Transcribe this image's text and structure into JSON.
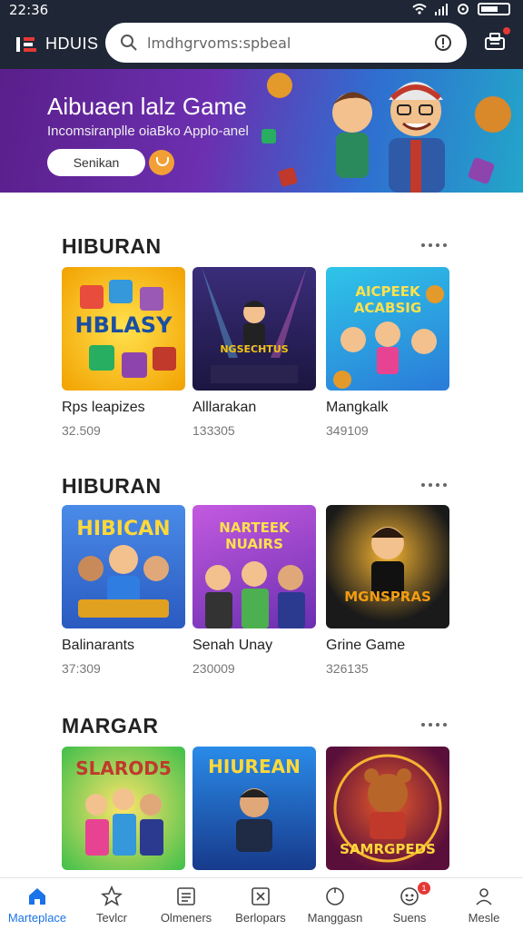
{
  "status_bar": {
    "time": "22:36"
  },
  "header": {
    "brand": "HDUIS",
    "search_text": "lmdhgrvoms:spbeal"
  },
  "banner": {
    "title": "Aibuaen lalz Game",
    "subtitle": "Incomsiranplle oiaBko Applo-anel",
    "button_label": "Senikan"
  },
  "sections": [
    {
      "title": "HIBURAN",
      "items": [
        {
          "name": "Rps leapizes",
          "count": "32.509",
          "art_text": "HBLASY"
        },
        {
          "name": "Alllarakan",
          "count": "133305",
          "art_text": "NGSECHTUS"
        },
        {
          "name": "Mangkalk",
          "count": "349109",
          "art_text": "AICPEEK ACABSIG"
        }
      ]
    },
    {
      "title": "HIBURAN",
      "items": [
        {
          "name": "Balinarants",
          "count": "37:309",
          "art_text": "HIBICAN"
        },
        {
          "name": "Senah Unay",
          "count": "230009",
          "art_text": "NARTEEK NUAIRS"
        },
        {
          "name": "Grine Game",
          "count": "326135",
          "art_text": "MGNSPRAS"
        }
      ]
    },
    {
      "title": "MARGAR",
      "items": [
        {
          "name": "",
          "count": "",
          "art_text": "SLAROD5"
        },
        {
          "name": "",
          "count": "",
          "art_text": "HIUREAN"
        },
        {
          "name": "",
          "count": "",
          "art_text": "SAMRGPEDS"
        }
      ]
    }
  ],
  "bottom_nav": [
    {
      "label": "Marteplace",
      "icon": "home-icon",
      "active": true
    },
    {
      "label": "Tevlcr",
      "icon": "star-icon",
      "active": false
    },
    {
      "label": "Olmeners",
      "icon": "list-icon",
      "active": false
    },
    {
      "label": "Berlopars",
      "icon": "grid-icon",
      "active": false
    },
    {
      "label": "Manggasn",
      "icon": "circle-icon",
      "active": false
    },
    {
      "label": "Suens",
      "icon": "game-icon",
      "active": false,
      "badge": "1"
    },
    {
      "label": "Mesle",
      "icon": "user-icon",
      "active": false
    }
  ],
  "colors": {
    "accent": "#1a73e8",
    "header_bg": "#1f2736",
    "banner_start": "#5a1f8a",
    "banner_end": "#23a6c9",
    "badge": "#e53935"
  }
}
